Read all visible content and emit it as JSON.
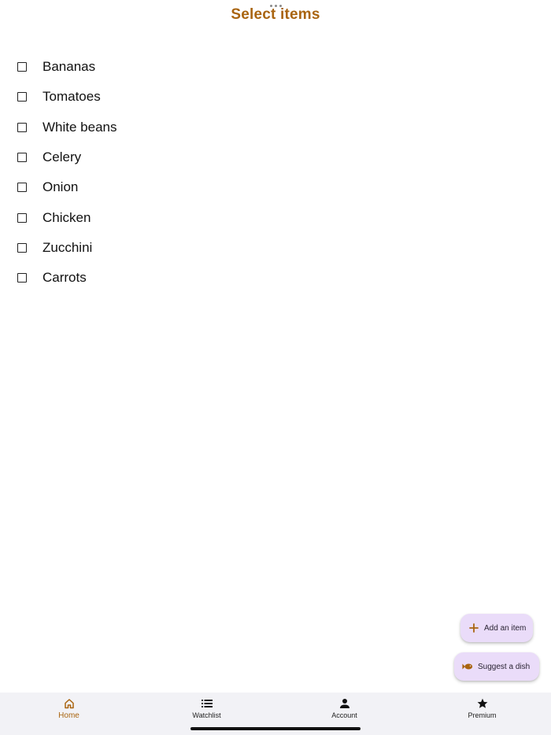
{
  "header": {
    "title": "Select items"
  },
  "items": [
    {
      "label": "Bananas",
      "checked": false
    },
    {
      "label": "Tomatoes",
      "checked": false
    },
    {
      "label": "White beans",
      "checked": false
    },
    {
      "label": "Celery",
      "checked": false
    },
    {
      "label": "Onion",
      "checked": false
    },
    {
      "label": "Chicken",
      "checked": false
    },
    {
      "label": "Zucchini",
      "checked": false
    },
    {
      "label": "Carrots",
      "checked": false
    }
  ],
  "fabs": {
    "add_label": "Add an item",
    "add_icon": "plus-icon",
    "suggest_label": "Suggest a dish",
    "suggest_icon": "fish-icon"
  },
  "nav": [
    {
      "label": "Home",
      "icon": "home-icon",
      "active": true
    },
    {
      "label": "Watchlist",
      "icon": "list-icon",
      "active": false
    },
    {
      "label": "Account",
      "icon": "person-icon",
      "active": false
    },
    {
      "label": "Premium",
      "icon": "star-icon",
      "active": false
    }
  ],
  "colors": {
    "accent": "#a9640f",
    "fab_background": "#eadcf9",
    "nav_background": "#f2f2f6"
  }
}
